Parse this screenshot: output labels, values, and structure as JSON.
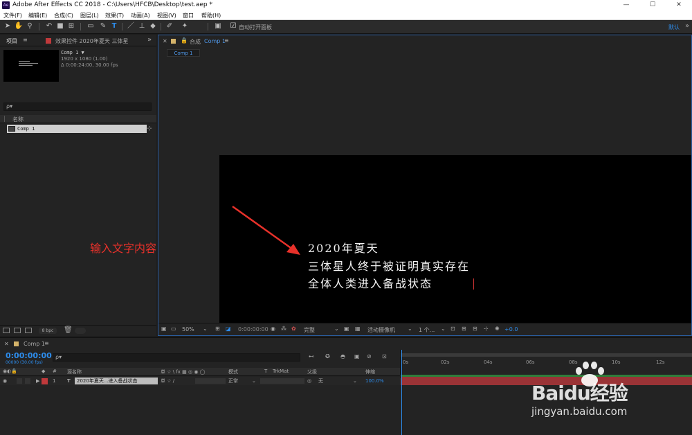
{
  "window": {
    "app_logo": "Ae",
    "title": "Adobe After Effects CC 2018 - C:\\Users\\HFCB\\Desktop\\test.aep *",
    "controls": [
      "—",
      "☐",
      "✕"
    ]
  },
  "menu": [
    "文件(F)",
    "编辑(E)",
    "合成(C)",
    "图层(L)",
    "效果(T)",
    "动画(A)",
    "视图(V)",
    "窗口",
    "帮助(H)"
  ],
  "toolbar": {
    "auto_open_label": "自动打开面板",
    "workspace": "默认",
    "more": "»"
  },
  "project_panel": {
    "tab_project": "项目",
    "tab_menu": "≡",
    "tab_effects": "效果控件 2020年夏天 三体星",
    "expand": "»",
    "comp_name": "Comp 1 ▼",
    "comp_size": "1920 x 1080 (1.00)",
    "comp_duration": "Δ 0:00:24:00, 30.00 fps",
    "search_placeholder": "ρ▾",
    "column_name": "名称",
    "item_name": "Comp 1",
    "bpc": "8 bpc"
  },
  "viewer": {
    "tab_label": "合成",
    "tab_comp": "Comp 1",
    "tab_menu": "≡",
    "subtab": "Comp 1",
    "text_lines": [
      "2020年夏天",
      "三体星人终于被证明真实存在",
      "全体人类进入备战状态"
    ],
    "zoom": "50%",
    "timecode": "0:00:00:00",
    "quality": "完整",
    "camera": "活动摄像机",
    "views": "1 个...",
    "exposure": "+0.0"
  },
  "annotation": "输入文字内容",
  "timeline": {
    "tab_label": "Comp 1",
    "tab_menu": "≡",
    "timecode": "0:00:00:00",
    "fps_line": "00000 (30.00 fps)",
    "search_placeholder": "ρ▾",
    "columns": {
      "switches": "◉◐🔒",
      "label": "◆",
      "num": "#",
      "source": "源名称",
      "switch_icons": "单 ☆ \\ fx ▦ ◎ ◉ ◯",
      "mode": "模式",
      "t": "T",
      "trkmat": "TrkMat",
      "parent": "父级",
      "stretch": "伸缩"
    },
    "layer": {
      "num": "1",
      "type": "T",
      "name": "2020年夏天...进入备战状态",
      "mode": "正常",
      "parent": "无",
      "stretch": "100.0%"
    },
    "ruler_ticks": [
      "0s",
      "02s",
      "04s",
      "06s",
      "08s",
      "10s",
      "12s"
    ]
  },
  "watermark": {
    "brand": "Baidu经验",
    "url": "jingyan.baidu.com"
  },
  "colors": {
    "accent": "#2d8ceb",
    "layer_bar": "#9a3336",
    "annotation": "#e8312a"
  }
}
